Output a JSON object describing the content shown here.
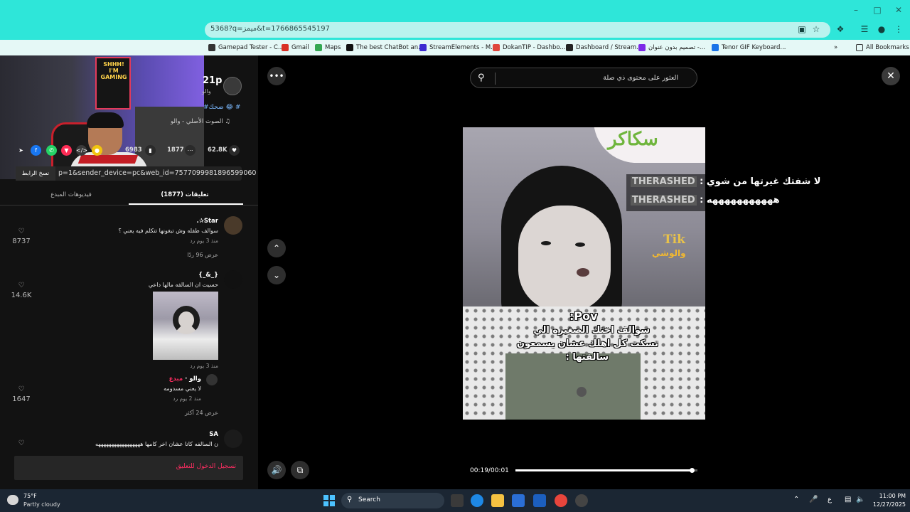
{
  "browser": {
    "url": "5368?q=ميمز&t=1766865545197",
    "window_controls": {
      "minimize": "–",
      "maximize": "□",
      "close": "✕"
    },
    "bookmarks": [
      {
        "label": "Gamepad Tester - C...",
        "icon_color": "#333333"
      },
      {
        "label": "Gmail",
        "icon_color": "#d93025"
      },
      {
        "label": "Maps",
        "icon_color": "#34a853"
      },
      {
        "label": "The best ChatBot an...",
        "icon_color": "#111111"
      },
      {
        "label": "StreamElements - M...",
        "icon_color": "#3d2bd1"
      },
      {
        "label": "DokanTIP - Dashbo...",
        "icon_color": "#e0463c"
      },
      {
        "label": "Dashboard / Stream...",
        "icon_color": "#222222"
      },
      {
        "label": "تصميم بدون عنوان -...",
        "icon_color": "#7d2ae8"
      },
      {
        "label": "Tenor GIF Keyboard...",
        "icon_color": "#1a73e8"
      }
    ],
    "bookmarks_more": "»",
    "all_bookmarks": "All Bookmarks"
  },
  "webcam": {
    "poster_text": "SHHH! I'M GAMING"
  },
  "post": {
    "author_tag": "21p",
    "author_sub": "والو",
    "tags": "#ضحك 😂 #",
    "sound": "♫ الصوت الأصلي - والو"
  },
  "actions": {
    "likes": "62.8K",
    "comments": "1877",
    "saves": "6983"
  },
  "share_link": {
    "copy_label": "نسخ الرابط",
    "link_text": "p=1&sender_device=pc&web_id=7577099981896599060"
  },
  "tabs": {
    "comments": "(1877) تعليقات",
    "creator_videos": "فيديوهات المبدع"
  },
  "comments": [
    {
      "name": "Star✰.",
      "text": "سوالف طفله وش تبغونها تتكلم فيه يعني ؟",
      "meta": "منذ 3 يوم    رد",
      "likes": "8737",
      "more": "عرض 96 ردًا"
    },
    {
      "name": "{_&_}",
      "text": "حسيت ان السالفه مالها داعي",
      "meta": "منذ 3 يوم    رد",
      "likes": "14.6K"
    },
    {
      "name": "والو",
      "badge": "مبدع",
      "text": "لا يعني مسدومه",
      "meta": "منذ 2 يوم    رد",
      "likes": "1647",
      "more": "عرض 24 أكثر"
    },
    {
      "name": "SA",
      "text": "ن السالفه كانا عشان اخر كامها هههههههههههههههههه",
      "likes": ""
    }
  ],
  "login_prompt": "تسجيل الدخول للتعليق",
  "video": {
    "search_placeholder": "العثور على محتوى ذي صلة",
    "logo_text": "سكاكر",
    "watermark_tik": "Tik",
    "watermark_brand": "والوشي",
    "caption_lines": [
      "Pov:",
      "سوالف اختك الصغيره الي",
      "تسكت كل اهلك عشان يسمعون",
      "سالفتها :"
    ],
    "time": "00:19/00:01",
    "progress": 0.97
  },
  "chat": [
    {
      "name": "THERASHED",
      "message": "لا شفتك غيرتها من شوي"
    },
    {
      "name": "THERASHED",
      "message": "هههههههههههه"
    }
  ],
  "taskbar": {
    "temp": "75°F",
    "weather": "Partly cloudy",
    "search": "Search",
    "time": "11:00 PM",
    "date": "12/27/2025",
    "lang": "ع"
  }
}
